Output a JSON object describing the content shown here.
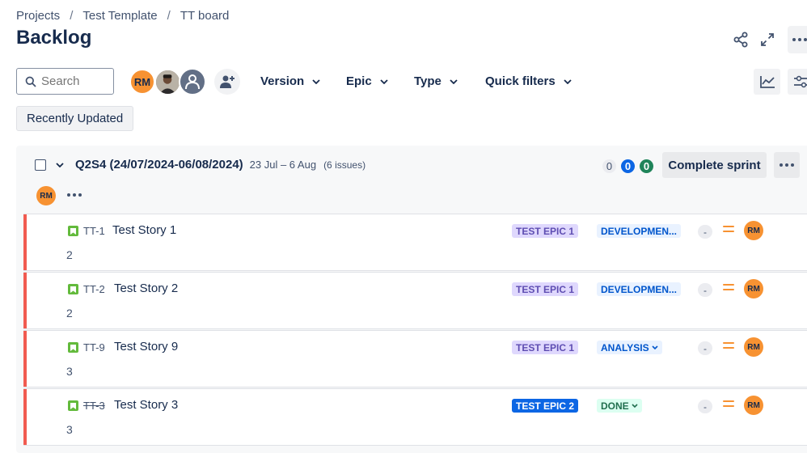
{
  "breadcrumb": {
    "items": [
      "Projects",
      "Test Template",
      "TT board"
    ],
    "separator": "/"
  },
  "page_title": "Backlog",
  "toolbar": {
    "search_placeholder": "Search",
    "assignee_initials": "RM",
    "filters": [
      "Version",
      "Epic",
      "Type",
      "Quick filters"
    ],
    "recently_updated": "Recently Updated"
  },
  "sprint": {
    "name": "Q2S4 (24/07/2024-06/08/2024)",
    "dates": "23 Jul – 6 Aug",
    "issue_count": "(6 issues)",
    "counts": {
      "todo": "0",
      "in_progress": "0",
      "done": "0"
    },
    "complete_label": "Complete sprint",
    "assignee_initials": "RM"
  },
  "issues": [
    {
      "key": "TT-1",
      "summary": "Test Story 1",
      "points": "2",
      "epic": "TEST EPIC 1",
      "status": "DEVELOPMEN...",
      "estimate": "-",
      "assignee": "RM"
    },
    {
      "key": "TT-2",
      "summary": "Test Story 2",
      "points": "2",
      "epic": "TEST EPIC 1",
      "status": "DEVELOPMEN...",
      "estimate": "-",
      "assignee": "RM"
    },
    {
      "key": "TT-9",
      "summary": "Test Story 9",
      "points": "3",
      "epic": "TEST EPIC 1",
      "status": "ANALYSIS",
      "estimate": "-",
      "assignee": "RM"
    },
    {
      "key": "TT-3",
      "summary": "Test Story 3",
      "points": "3",
      "epic": "TEST EPIC 2",
      "status": "DONE",
      "estimate": "-",
      "assignee": "RM"
    }
  ],
  "colors": {
    "accent": "#0c66e4",
    "issue_bar": "#f15b50",
    "story_icon": "#63ba3c",
    "avatar_orange": "#f79232",
    "epic1_bg": "#dfd8fd",
    "status_blue_bg": "#e9f2ff",
    "status_green_bg": "#dcfff1"
  },
  "icons": [
    "search-icon",
    "share-icon",
    "expand-icon",
    "more-icon",
    "add-people-icon",
    "chevron-down-icon",
    "insights-icon",
    "view-settings-icon",
    "story-icon",
    "priority-medium-icon"
  ]
}
